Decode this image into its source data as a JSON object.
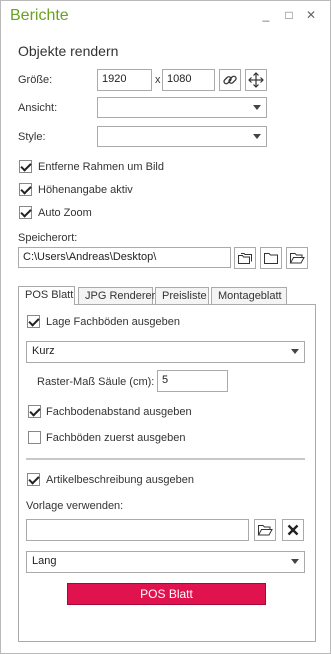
{
  "window": {
    "title": "Berichte",
    "minimize_glyph": "_",
    "maximize_glyph": "□",
    "close_glyph": "✕"
  },
  "section_title": "Objekte rendern",
  "size": {
    "label": "Größe:",
    "width": "1920",
    "separator": "x",
    "height": "1080"
  },
  "view": {
    "label": "Ansicht:",
    "value": ""
  },
  "style": {
    "label": "Style:",
    "value": ""
  },
  "options": [
    {
      "label": "Entferne Rahmen um Bild",
      "checked": true
    },
    {
      "label": "Höhenangabe aktiv",
      "checked": true
    },
    {
      "label": "Auto Zoom",
      "checked": true
    }
  ],
  "save_location": {
    "label": "Speicherort:",
    "value": "C:\\Users\\Andreas\\Desktop\\"
  },
  "tabs": [
    {
      "label": "POS Blatt",
      "active": true
    },
    {
      "label": "JPG Renderer",
      "active": false
    },
    {
      "label": "Preisliste",
      "active": false
    },
    {
      "label": "Montageblatt",
      "active": false
    }
  ],
  "pos": {
    "shelf_output_label": "Lage Fachböden ausgeben",
    "shelf_output_checked": true,
    "format_value": "Kurz",
    "grid_label": "Raster-Maß Säule (cm):",
    "grid_value": "5",
    "shelf_distance_label": "Fachbodenabstand ausgeben",
    "shelf_distance_checked": true,
    "shelves_first_label": "Fachböden zuerst ausgeben",
    "shelves_first_checked": false,
    "article_desc_label": "Artikelbeschreibung ausgeben",
    "article_desc_checked": true,
    "template_label": "Vorlage verwenden:",
    "template_value": "",
    "length_value": "Lang",
    "button_label": "POS Blatt",
    "button_color": "#e0134f"
  },
  "colors": {
    "title": "#6aa121",
    "accent": "#e0134f"
  }
}
